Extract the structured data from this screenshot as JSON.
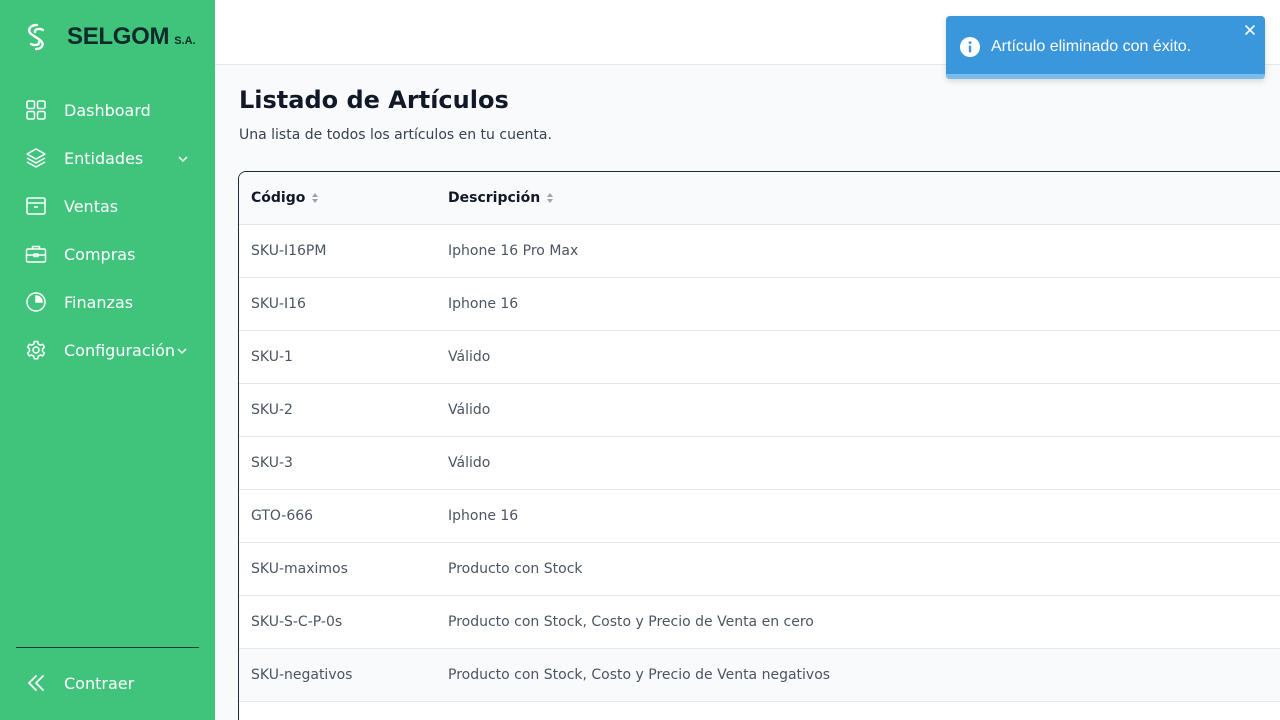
{
  "brand": {
    "name": "SELGOM",
    "suffix": "S.A."
  },
  "sidebar": {
    "items": [
      {
        "label": "Dashboard",
        "icon": "grid-icon"
      },
      {
        "label": "Entidades",
        "icon": "layers-icon",
        "has_submenu": true
      },
      {
        "label": "Ventas",
        "icon": "archive-box-icon"
      },
      {
        "label": "Compras",
        "icon": "briefcase-icon"
      },
      {
        "label": "Finanzas",
        "icon": "pie-chart-icon"
      },
      {
        "label": "Configuración",
        "icon": "gear-icon",
        "has_submenu": true
      }
    ],
    "collapse_label": "Contraer"
  },
  "page": {
    "title": "Listado de Artículos",
    "subtitle": "Una lista de todos los artículos en tu cuenta."
  },
  "table": {
    "columns": [
      "Código",
      "Descripción"
    ],
    "rows": [
      {
        "code": "SKU-I16PM",
        "description": "Iphone 16 Pro Max"
      },
      {
        "code": "SKU-I16",
        "description": "Iphone 16"
      },
      {
        "code": "SKU-1",
        "description": "Válido"
      },
      {
        "code": "SKU-2",
        "description": "Válido"
      },
      {
        "code": "SKU-3",
        "description": "Válido"
      },
      {
        "code": "GTO-666",
        "description": "Iphone 16"
      },
      {
        "code": "SKU-maximos",
        "description": "Producto con Stock"
      },
      {
        "code": "SKU-S-C-P-0s",
        "description": "Producto con Stock, Costo y Precio de Venta en cero"
      },
      {
        "code": "SKU-negativos",
        "description": "Producto con Stock, Costo y Precio de Venta negativos"
      }
    ]
  },
  "toast": {
    "message": "Artículo eliminado con éxito.",
    "icon": "info-icon"
  },
  "colors": {
    "sidebar_bg": "#40c47c",
    "toast_bg": "#3b97dc",
    "brand_text": "#0f2a2a"
  }
}
